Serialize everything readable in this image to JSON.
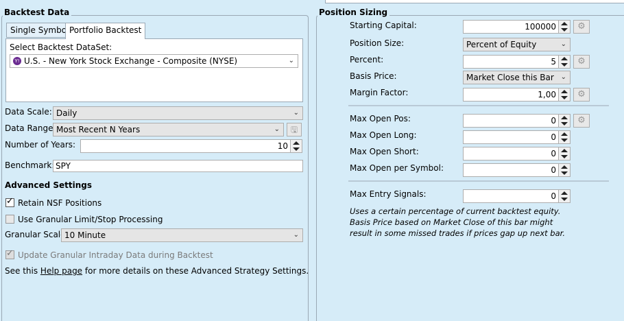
{
  "left": {
    "title": "Backtest Data",
    "tabs": [
      {
        "label": "Single Symbol"
      },
      {
        "label": "Portfolio Backtest"
      }
    ],
    "dataset_label": "Select Backtest DataSet:",
    "dataset_value": "U.S. - New York Stock Exchange - Composite (NYSE)",
    "data_scale_label": "Data Scale:",
    "data_scale_value": "Daily",
    "data_range_label": "Data Range:",
    "data_range_value": "Most Recent N Years",
    "years_label": "Number of Years:",
    "years_value": "10",
    "benchmark_label": "Benchmark:",
    "benchmark_value": "SPY",
    "advanced_title": "Advanced Settings",
    "retain_nsf_label": "Retain NSF Positions",
    "granular_label": "Use Granular Limit/Stop Processing",
    "granular_scale_label": "Granular Scale",
    "granular_scale_value": "10 Minute",
    "update_intraday_label": "Update Granular Intraday Data during Backtest",
    "help_prefix": "See this ",
    "help_link": "Help page",
    "help_suffix": " for more details on these Advanced Strategy Settings."
  },
  "right": {
    "title": "Position Sizing",
    "starting_capital_label": "Starting Capital:",
    "starting_capital_value": "100000",
    "position_size_label": "Position Size:",
    "position_size_value": "Percent of Equity",
    "percent_label": "Percent:",
    "percent_value": "5",
    "basis_price_label": "Basis Price:",
    "basis_price_value": "Market Close this Bar",
    "margin_label": "Margin Factor:",
    "margin_value": "1,00",
    "max_open_pos_label": "Max Open Pos:",
    "max_open_pos_value": "0",
    "max_open_long_label": "Max Open Long:",
    "max_open_long_value": "0",
    "max_open_short_label": "Max Open Short:",
    "max_open_short_value": "0",
    "max_open_symbol_label": "Max Open per Symbol:",
    "max_open_symbol_value": "0",
    "max_entry_label": "Max Entry Signals:",
    "max_entry_value": "0",
    "description": "Uses a certain percentage of current backtest equity. Basis Price based on Market Close of this bar might result in some missed trades if prices gap up next bar."
  }
}
